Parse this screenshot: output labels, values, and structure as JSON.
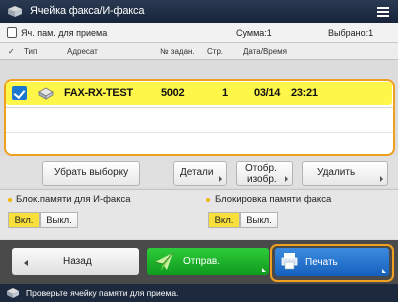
{
  "titlebar": {
    "title": "Ячейка факса/И-факса",
    "icon": "fax-inbox-icon",
    "menu_icon": "hamburger-menu-icon"
  },
  "infobar": {
    "box_label": "Яч. пам. для приема",
    "total": "Сумма:1",
    "selected": "Выбрано:1"
  },
  "columns": {
    "check": "✓",
    "type": "Тип",
    "address": "Адресат",
    "job_no": "№ задан.",
    "pages": "Стр.",
    "datetime": "Дата/Время"
  },
  "rows": [
    {
      "selected": true,
      "address": "FAX-RX-TEST",
      "job_no": "5002",
      "pages": "1",
      "date": "03/14",
      "time": "23:21"
    }
  ],
  "actions": {
    "clear_selection": "Убрать выборку",
    "details": "Детали",
    "display_image_1": "Отобр.",
    "display_image_2": "изобр.",
    "delete": "Удалить"
  },
  "lock_ifax": {
    "label": "Блок.памяти для И-факса",
    "on": "Вкл.",
    "off": "Выкл.",
    "state": "on"
  },
  "lock_fax": {
    "label": "Блокировка памяти факса",
    "on": "Вкл.",
    "off": "Выкл.",
    "state": "on"
  },
  "nav": {
    "back": "Назад",
    "send": "Отправ.",
    "print": "Печать"
  },
  "status": {
    "text": "Проверьте ячейку памяти для приема."
  },
  "colors": {
    "selection": "#fff64a",
    "focus": "#f0a020",
    "send": "#18b02a",
    "print": "#1a6fd0",
    "toggle_on": "#f8df3c"
  }
}
